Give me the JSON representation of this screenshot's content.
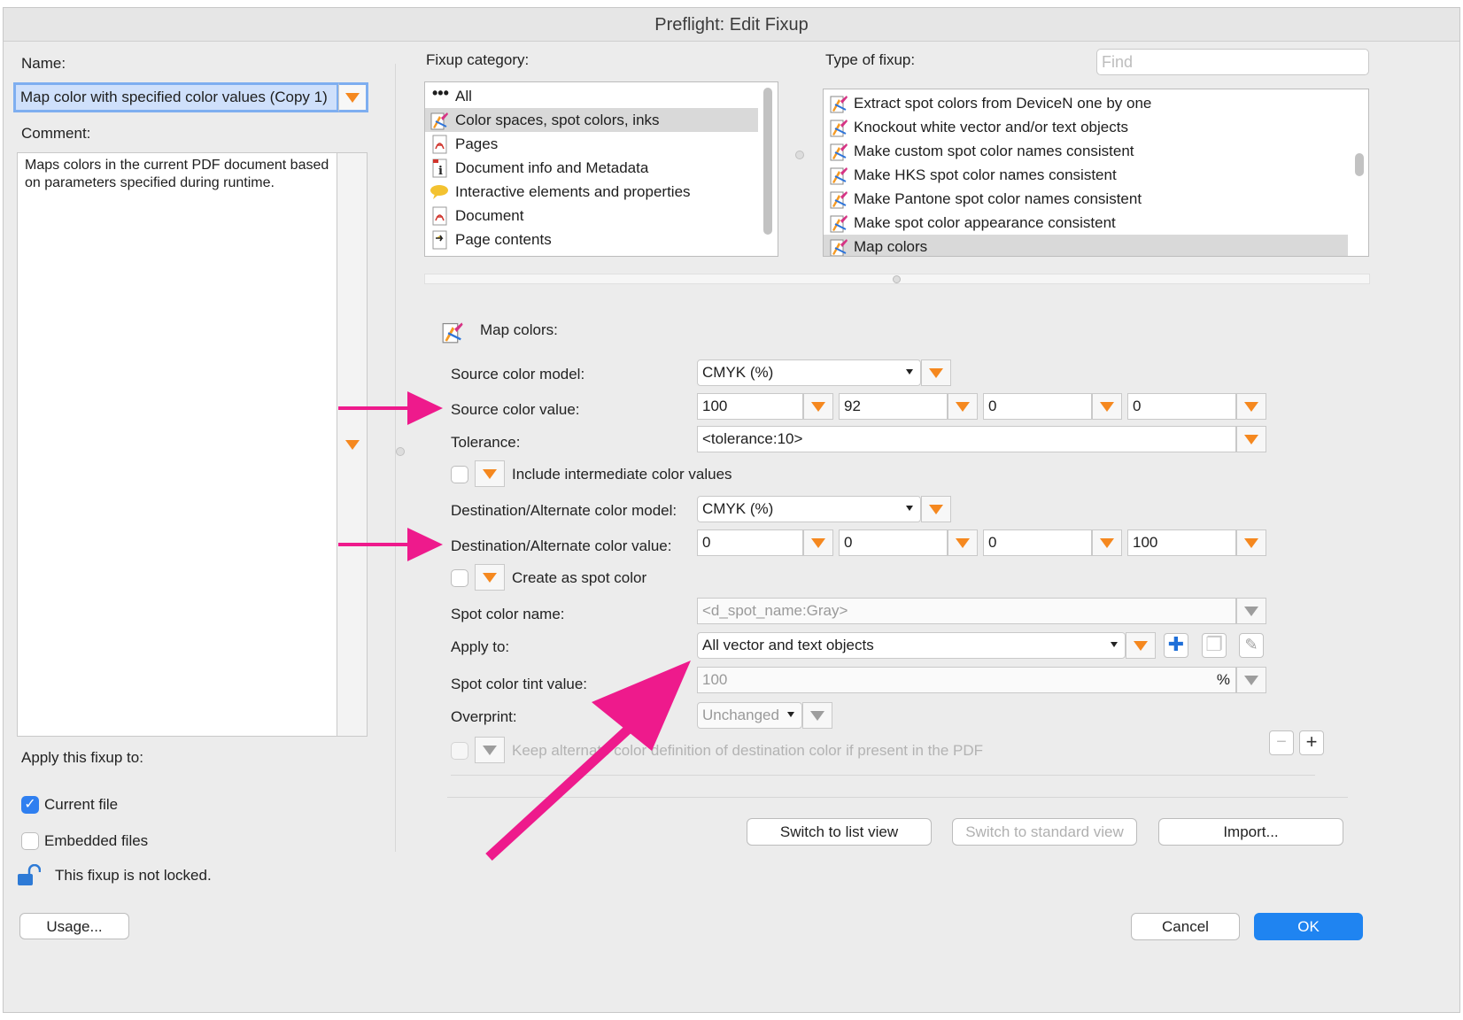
{
  "window": {
    "title": "Preflight: Edit Fixup"
  },
  "left": {
    "name_label": "Name:",
    "name_value": "Map color with specified color values (Copy 1)",
    "comment_label": "Comment:",
    "comment_value": "Maps colors in the current PDF document based on parameters specified during runtime.",
    "apply_label": "Apply this fixup to:",
    "current_file": "Current file",
    "embedded_files": "Embedded files",
    "lock_text": "This fixup is not locked.",
    "usage_button": "Usage..."
  },
  "category": {
    "label": "Fixup category:",
    "items": [
      {
        "label": "All",
        "icon": "ellipsis-icon"
      },
      {
        "label": "Color spaces, spot colors, inks",
        "icon": "color-fixup-icon",
        "selected": true
      },
      {
        "label": "Pages",
        "icon": "pdf-icon"
      },
      {
        "label": "Document info and Metadata",
        "icon": "info-icon"
      },
      {
        "label": "Interactive elements and properties",
        "icon": "comment-icon"
      },
      {
        "label": "Document",
        "icon": "pdf-icon"
      },
      {
        "label": "Page contents",
        "icon": "page-contents-icon"
      }
    ]
  },
  "type": {
    "label": "Type of fixup:",
    "find_placeholder": "Find",
    "items": [
      {
        "label": "Extract spot colors from DeviceN one by one"
      },
      {
        "label": "Knockout white vector and/or text objects"
      },
      {
        "label": "Make custom spot color names consistent"
      },
      {
        "label": "Make HKS spot color names consistent"
      },
      {
        "label": "Make Pantone spot color names consistent"
      },
      {
        "label": "Make spot color appearance consistent"
      },
      {
        "label": "Map colors",
        "selected": true
      }
    ]
  },
  "params": {
    "section_title": "Map colors:",
    "source_model_label": "Source color model:",
    "source_model_value": "CMYK (%)",
    "source_value_label": "Source color value:",
    "source_values": [
      "100",
      "92",
      "0",
      "0"
    ],
    "tolerance_label": "Tolerance:",
    "tolerance_value": "<tolerance:10>",
    "include_intermediate": "Include intermediate color values",
    "dest_model_label": "Destination/Alternate color model:",
    "dest_model_value": "CMYK (%)",
    "dest_value_label": "Destination/Alternate color value:",
    "dest_values": [
      "0",
      "0",
      "0",
      "100"
    ],
    "create_spot": "Create as spot color",
    "spot_name_label": "Spot color name:",
    "spot_name_value": "<d_spot_name:Gray>",
    "apply_to_label": "Apply to:",
    "apply_to_value": "All vector and text objects",
    "tint_label": "Spot color tint value:",
    "tint_value": "100",
    "tint_unit": "%",
    "overprint_label": "Overprint:",
    "overprint_value": "Unchanged",
    "keep_alternate": "Keep alternate color definition of destination color if present in the PDF"
  },
  "buttons": {
    "list_view": "Switch to list view",
    "standard_view": "Switch to standard view",
    "import": "Import...",
    "cancel": "Cancel",
    "ok": "OK",
    "minus": "−",
    "plus": "+"
  },
  "colors": {
    "accent_orange": "#f5881f",
    "annotation_pink": "#ee1a8c",
    "primary_blue": "#1f84f1"
  }
}
